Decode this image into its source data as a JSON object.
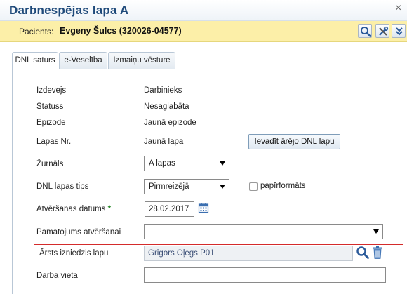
{
  "window": {
    "title": "Darbnespējas lapa A",
    "close_glyph": "×"
  },
  "patient": {
    "label": "Pacients:",
    "name": "Evgeny Šulcs (320026-04577)"
  },
  "toolbar": {
    "icons": [
      "search-icon",
      "settings-tools-icon",
      "collapse-double-chevron-icon"
    ]
  },
  "tabs": [
    {
      "label": "DNL saturs",
      "active": true
    },
    {
      "label": "e-Veselība",
      "active": false
    },
    {
      "label": "Izmaiņu vēsture",
      "active": false
    }
  ],
  "form": {
    "izdevejs": {
      "label": "Izdevejs",
      "value": "Darbinieks"
    },
    "statuss": {
      "label": "Statuss",
      "value": "Nesaglabāta"
    },
    "epizode": {
      "label": "Epizode",
      "value": "Jaunā epizode"
    },
    "lapas_nr": {
      "label": "Lapas Nr.",
      "value": "Jaunā lapa",
      "button": "Ievadīt ārējo DNL lapu"
    },
    "zurnals": {
      "label": "Žurnāls",
      "value": "A lapas"
    },
    "dnl_tips": {
      "label": "DNL lapas tips",
      "value": "Pirmreizējā",
      "checkbox_label": "papīrformāts",
      "checkbox_checked": false
    },
    "atversanas_datums": {
      "label": "Atvēršanas datums",
      "required_mark": "*",
      "value": "28.02.2017"
    },
    "pamatojums": {
      "label": "Pamatojums atvēršanai",
      "value": ""
    },
    "arsts": {
      "label": "Ārsts izniedzis lapu",
      "value": "Grigors Oļegs P01"
    },
    "darba_vieta": {
      "label": "Darba vieta",
      "value": ""
    }
  },
  "colors": {
    "title": "#1f4a7a",
    "patient_bar": "#fcefa8",
    "highlight_border": "#d42b2b",
    "icon_blue": "#2a5a9a"
  }
}
